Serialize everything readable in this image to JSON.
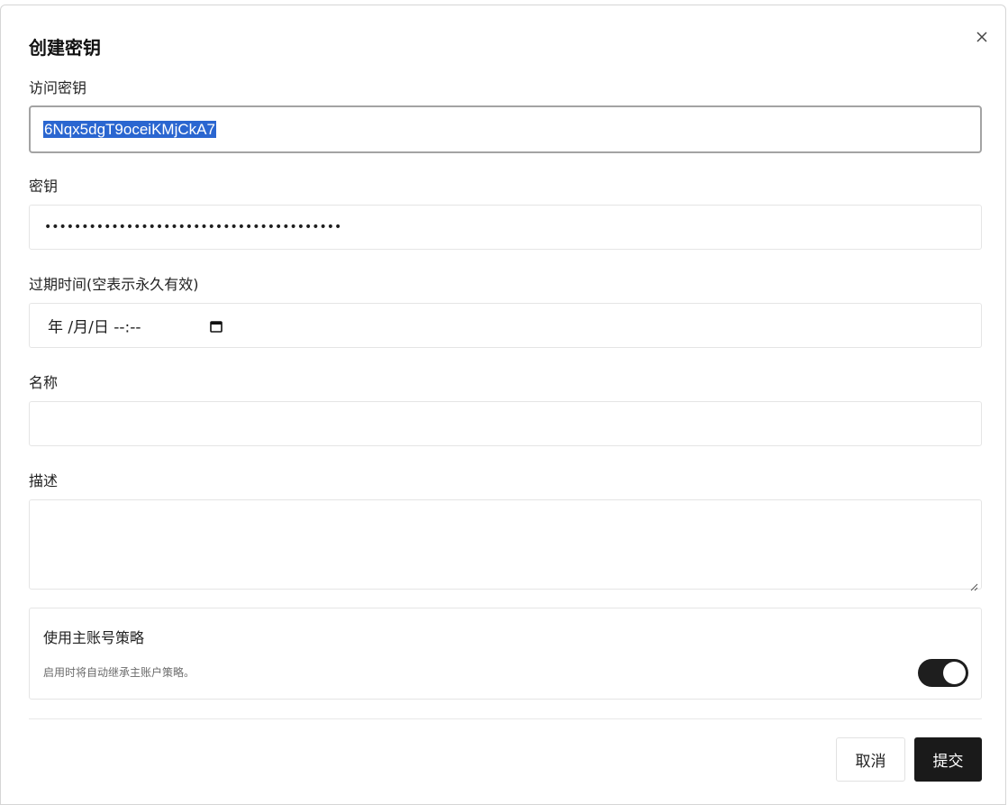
{
  "dialog": {
    "title": "创建密钥",
    "close_icon": "close-icon"
  },
  "form": {
    "access_key": {
      "label": "访问密钥",
      "value": "6Nqx5dgT9oceiKMjCkA7"
    },
    "secret_key": {
      "label": "密钥",
      "masked_value": "••••••••••••••••••••••••••••••••••••••••"
    },
    "expiry": {
      "label": "过期时间(空表示永久有效)",
      "placeholder": "年 /月/日 --:--",
      "icon": "calendar-icon"
    },
    "name": {
      "label": "名称",
      "value": ""
    },
    "description": {
      "label": "描述",
      "value": ""
    },
    "policy": {
      "title": "使用主账号策略",
      "description": "启用时将自动继承主账户策略。",
      "enabled": true
    }
  },
  "footer": {
    "cancel_label": "取消",
    "submit_label": "提交"
  }
}
